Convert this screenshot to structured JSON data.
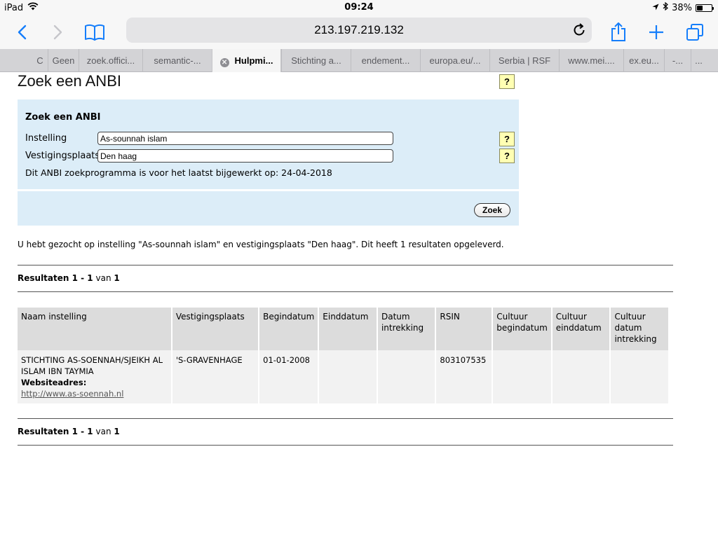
{
  "status_bar": {
    "device": "iPad",
    "time": "09:24",
    "battery_percent_text": "38%",
    "battery_level": 0.38
  },
  "toolbar": {
    "url": "213.197.219.132"
  },
  "tabs": [
    {
      "label": "C"
    },
    {
      "label": "Geen"
    },
    {
      "label": "zoek.offici..."
    },
    {
      "label": "semantic-..."
    },
    {
      "label": "Hulpmi...",
      "active": true
    },
    {
      "label": "Stichting a..."
    },
    {
      "label": "endement..."
    },
    {
      "label": "europa.eu/..."
    },
    {
      "label": "Serbia | RSF"
    },
    {
      "label": "www.mei...."
    },
    {
      "label": "ex.eu..."
    },
    {
      "label": "-..."
    },
    {
      "label": "..."
    }
  ],
  "page": {
    "title": "Zoek een ANBI",
    "help_symbol": "?",
    "form": {
      "heading": "Zoek een ANBI",
      "instelling_label": "Instelling",
      "instelling_value": "As-sounnah islam",
      "vestigingsplaats_label": "Vestigingsplaats",
      "vestigingsplaats_value": "Den haag",
      "update_note": "Dit ANBI zoekprogramma is voor het laatst bijgewerkt op: 24-04-2018",
      "submit_label": "Zoek"
    },
    "search_summary": "U hebt gezocht op instelling \"As-sounnah islam\" en vestigingsplaats \"Den haag\". Dit heeft 1 resultaten opgeleverd.",
    "results_count": {
      "prefix": "Resultaten 1 - 1",
      "middle": "van",
      "total": "1"
    },
    "table": {
      "headers": [
        "Naam instelling",
        "Vestigingsplaats",
        "Begindatum",
        "Einddatum",
        "Datum intrekking",
        "RSIN",
        "Cultuur begindatum",
        "Cultuur einddatum",
        "Cultuur datum intrekking"
      ],
      "rows": [
        {
          "naam": "STICHTING AS-SOENNAH/SJEIKH AL ISLAM IBN TAYMIA",
          "website_label": "Websiteadres:",
          "website_url": "http://www.as-soennah.nl",
          "vestigingsplaats": "'S-GRAVENHAGE",
          "begindatum": "01-01-2008",
          "einddatum": "",
          "datum_intrekking": "",
          "rsin": "803107535",
          "cultuur_begindatum": "",
          "cultuur_einddatum": "",
          "cultuur_datum_intrekking": ""
        }
      ]
    }
  }
}
